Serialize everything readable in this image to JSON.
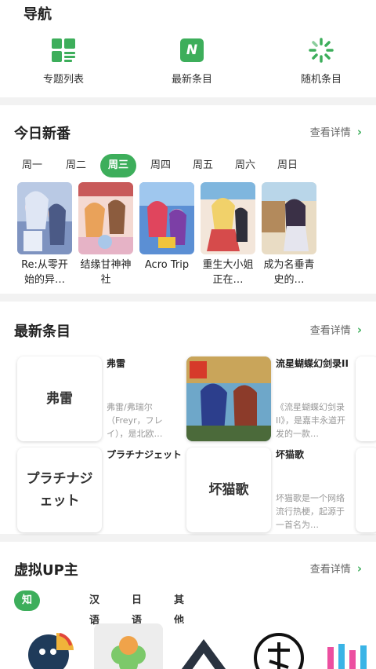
{
  "nav": {
    "title": "导航",
    "items": [
      {
        "label": "专题列表",
        "icon": "grid-list-icon"
      },
      {
        "label": "最新条目",
        "icon": "new-badge-icon",
        "badge": "N"
      },
      {
        "label": "随机条目",
        "icon": "random-spinner-icon"
      }
    ]
  },
  "today": {
    "title": "今日新番",
    "more": "查看详情",
    "days": [
      "周一",
      "周二",
      "周三",
      "周四",
      "周五",
      "周六",
      "周日"
    ],
    "active_day": "周三",
    "anime": [
      {
        "name": "Re:从零开始的异…"
      },
      {
        "name": "结缘甘神神社"
      },
      {
        "name": "Acro Trip"
      },
      {
        "name": "重生大小姐正在…"
      },
      {
        "name": "成为名垂青史的…"
      }
    ]
  },
  "latest": {
    "title": "最新条目",
    "more": "查看详情",
    "items": [
      {
        "thumb_text": "弗雷",
        "title": "弗雷",
        "desc": "弗雷/弗瑞尔（Freyr，フレイ），是北欧…"
      },
      {
        "thumb_text": "",
        "title": "流星蝴蝶幻剑录II",
        "desc": "《流星蝴蝶幻剑录II》，是嘉丰永道开发的一款…"
      },
      {
        "thumb_text": "プラチナジェット",
        "title": "プラチナジェット",
        "desc": ""
      },
      {
        "thumb_text": "坏猫歌",
        "title": "坏猫歌",
        "desc": "坏猫歌是一个网络流行热梗，起源于一首名为…"
      }
    ]
  },
  "vup": {
    "title": "虚拟UP主",
    "more": "查看详情",
    "langs": [
      "知名团体",
      "汉语",
      "日语",
      "其他语言"
    ],
    "active_lang": "知名团体"
  },
  "colors": {
    "accent": "#3dae5b"
  }
}
